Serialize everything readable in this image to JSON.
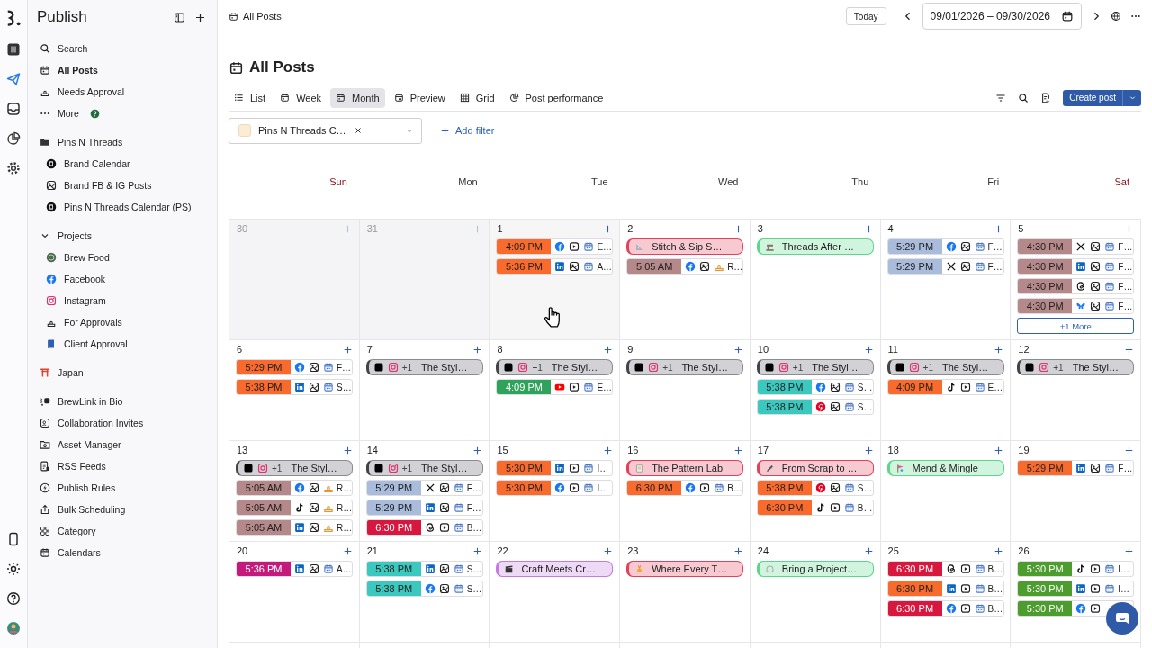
{
  "rail": [
    {
      "kind": "logo",
      "selected": false
    },
    {
      "kind": "app",
      "selected": false
    },
    {
      "kind": "plane",
      "selected": true
    },
    {
      "kind": "inbox",
      "selected": false
    },
    {
      "kind": "pie",
      "selected": false
    },
    {
      "kind": "gear",
      "selected": false
    }
  ],
  "rail_bottom": [
    {
      "kind": "phone"
    },
    {
      "kind": "sun"
    },
    {
      "kind": "help"
    },
    {
      "kind": "avatar"
    }
  ],
  "sidebar": {
    "title": "Publish",
    "sections": [
      {
        "items": [
          {
            "label": "Search",
            "kind": "search",
            "selected": false
          },
          {
            "label": "All Posts",
            "kind": "calendar",
            "selected": true
          },
          {
            "label": "Needs Approval",
            "kind": "stamp",
            "selected": false
          },
          {
            "label": "More",
            "kind": "dots",
            "badge": true,
            "selected": false
          }
        ]
      },
      {
        "items": [
          {
            "label": "Pins N Threads",
            "kind": "folder",
            "selected": false,
            "children": [
              {
                "label": "Brand Calendar",
                "kind": "darkcircle",
                "selected": false
              },
              {
                "label": "Brand FB & IG Posts",
                "kind": "image",
                "selected": false
              },
              {
                "label": "Pins N Threads Calendar (PS)",
                "kind": "darkcircle",
                "selected": false
              }
            ]
          }
        ]
      },
      {
        "items": [
          {
            "label": "Projects",
            "kind": "chevron",
            "expanded": true,
            "selected": false,
            "children": [
              {
                "label": "Brew Food",
                "kind": "brew",
                "selected": false
              },
              {
                "label": "Facebook",
                "kind": "facebook",
                "selected": false
              },
              {
                "label": "Instagram",
                "kind": "instagram",
                "selected": false
              },
              {
                "label": "For Approvals",
                "kind": "stamp",
                "selected": false
              },
              {
                "label": "Client Approval",
                "kind": "book",
                "selected": false
              }
            ]
          }
        ]
      },
      {
        "items": [
          {
            "label": "Japan",
            "kind": "torii",
            "selected": false
          }
        ]
      },
      {
        "items": [
          {
            "label": "BrewLink in Bio",
            "kind": "link",
            "selected": false
          },
          {
            "label": "Collaboration Invites",
            "kind": "personbox",
            "selected": false
          },
          {
            "label": "Asset Manager",
            "kind": "folderimage",
            "selected": false
          },
          {
            "label": "RSS Feeds",
            "kind": "doc",
            "selected": false
          },
          {
            "label": "Publish Rules",
            "kind": "bolt",
            "selected": false
          },
          {
            "label": "Bulk Scheduling",
            "kind": "upload",
            "selected": false
          },
          {
            "label": "Category",
            "kind": "grid",
            "selected": false
          },
          {
            "label": "Calendars",
            "kind": "calendar",
            "selected": false
          }
        ]
      }
    ]
  },
  "topbar": {
    "breadcrumb": "All Posts",
    "today": "Today",
    "date_range": "09/01/2026 – 09/30/2026"
  },
  "heading": "All Posts",
  "views": [
    {
      "label": "List",
      "kind": "list",
      "selected": false
    },
    {
      "label": "Week",
      "kind": "calendar",
      "selected": false
    },
    {
      "label": "Month",
      "kind": "calendar",
      "selected": true
    },
    {
      "label": "Preview",
      "kind": "preview",
      "selected": false
    },
    {
      "label": "Grid",
      "kind": "grid3",
      "selected": false
    },
    {
      "label": "Post performance",
      "kind": "pie",
      "selected": false
    }
  ],
  "create_button": "Create post",
  "filter": {
    "value": "Pins N Threads C…",
    "add_label": "Add filter"
  },
  "calendar": {
    "weekdays": [
      {
        "label": "Sun",
        "weekend": true
      },
      {
        "label": "Mon",
        "weekend": false
      },
      {
        "label": "Tue",
        "weekend": false
      },
      {
        "label": "Wed",
        "weekend": false
      },
      {
        "label": "Thu",
        "weekend": false
      },
      {
        "label": "Fri",
        "weekend": false
      },
      {
        "label": "Sat",
        "weekend": true
      }
    ],
    "weeks": [
      {
        "days": [
          {
            "date": "30",
            "outside": true,
            "hovered": false
          },
          {
            "date": "31",
            "outside": true,
            "hovered": false
          },
          {
            "date": "1",
            "outside": false,
            "hovered": true,
            "posts": [
              {
                "kind": "post",
                "time": "4:09 PM",
                "color": "#f96a2d",
                "icons": [
                  {
                    "kind": "facebook"
                  },
                  {
                    "kind": "video"
                  },
                  {
                    "kind": "calendar"
                  }
                ],
                "label": "E…"
              },
              {
                "kind": "post",
                "time": "5:36 PM",
                "color": "#f96a2d",
                "icons": [
                  {
                    "kind": "linkedin"
                  },
                  {
                    "kind": "image"
                  },
                  {
                    "kind": "calendar"
                  }
                ],
                "label": "A…"
              }
            ]
          },
          {
            "date": "2",
            "outside": false,
            "hovered": false,
            "posts": [
              {
                "kind": "event",
                "title": "Stitch & Sip S…",
                "color": "#e2405c",
                "icon": {
                  "kind": "ruler"
                }
              },
              {
                "kind": "post",
                "time": "5:05 AM",
                "color": "#b5888a",
                "icons": [
                  {
                    "kind": "facebook"
                  },
                  {
                    "kind": "image"
                  },
                  {
                    "kind": "approval"
                  }
                ],
                "label": "R…"
              }
            ]
          },
          {
            "date": "3",
            "outside": false,
            "hovered": false,
            "posts": [
              {
                "kind": "event",
                "title": "Threads After …",
                "color": "#5cd68a",
                "icon": {
                  "kind": "machine"
                }
              }
            ]
          },
          {
            "date": "4",
            "outside": false,
            "hovered": false,
            "posts": [
              {
                "kind": "post",
                "time": "5:29 PM",
                "color": "#a9bcdb",
                "icons": [
                  {
                    "kind": "facebook"
                  },
                  {
                    "kind": "image"
                  },
                  {
                    "kind": "calendar"
                  }
                ],
                "label": "F…"
              },
              {
                "kind": "post",
                "time": "5:29 PM",
                "color": "#a9bcdb",
                "icons": [
                  {
                    "kind": "x"
                  },
                  {
                    "kind": "image"
                  },
                  {
                    "kind": "calendar"
                  }
                ],
                "label": "F…"
              }
            ]
          },
          {
            "date": "5",
            "outside": false,
            "hovered": false,
            "more": "+1 More",
            "posts": [
              {
                "kind": "post",
                "time": "4:30 PM",
                "color": "#b5888a",
                "icons": [
                  {
                    "kind": "x"
                  },
                  {
                    "kind": "image"
                  },
                  {
                    "kind": "calendar"
                  }
                ],
                "label": "F…"
              },
              {
                "kind": "post",
                "time": "4:30 PM",
                "color": "#b5888a",
                "icons": [
                  {
                    "kind": "linkedin"
                  },
                  {
                    "kind": "image"
                  },
                  {
                    "kind": "calendar"
                  }
                ],
                "label": "F…"
              },
              {
                "kind": "post",
                "time": "4:30 PM",
                "color": "#b5888a",
                "icons": [
                  {
                    "kind": "threads"
                  },
                  {
                    "kind": "image"
                  },
                  {
                    "kind": "calendar"
                  }
                ],
                "label": "F…"
              },
              {
                "kind": "post",
                "time": "4:30 PM",
                "color": "#b5888a",
                "icons": [
                  {
                    "kind": "bluesky"
                  },
                  {
                    "kind": "image"
                  },
                  {
                    "kind": "calendar"
                  }
                ],
                "label": "F…"
              }
            ]
          }
        ]
      },
      {
        "days": [
          {
            "date": "6",
            "outside": false,
            "hovered": false,
            "posts": [
              {
                "kind": "post",
                "time": "5:29 PM",
                "color": "#f96a2d",
                "icons": [
                  {
                    "kind": "facebook"
                  },
                  {
                    "kind": "image"
                  },
                  {
                    "kind": "calendar"
                  }
                ],
                "label": "F…"
              },
              {
                "kind": "post",
                "time": "5:38 PM",
                "color": "#f96a2d",
                "icons": [
                  {
                    "kind": "linkedin"
                  },
                  {
                    "kind": "image"
                  },
                  {
                    "kind": "calendar"
                  }
                ],
                "label": "S…"
              }
            ]
          },
          {
            "date": "7",
            "outside": false,
            "hovered": false,
            "posts": [
              {
                "kind": "story",
                "extra": "+1",
                "title": "The Styl…"
              }
            ]
          },
          {
            "date": "8",
            "outside": false,
            "hovered": false,
            "posts": [
              {
                "kind": "story",
                "extra": "+1",
                "title": "The Styl…"
              },
              {
                "kind": "post",
                "time": "4:09 PM",
                "color": "#2fa25b",
                "icons": [
                  {
                    "kind": "youtube"
                  },
                  {
                    "kind": "video"
                  },
                  {
                    "kind": "calendar"
                  }
                ],
                "label": "E…"
              }
            ]
          },
          {
            "date": "9",
            "outside": false,
            "hovered": false,
            "posts": [
              {
                "kind": "story",
                "extra": "+1",
                "title": "The Styl…"
              }
            ]
          },
          {
            "date": "10",
            "outside": false,
            "hovered": false,
            "posts": [
              {
                "kind": "story",
                "extra": "+1",
                "title": "The Styl…"
              },
              {
                "kind": "post",
                "time": "5:38 PM",
                "color": "#3bc8bf",
                "icons": [
                  {
                    "kind": "facebook"
                  },
                  {
                    "kind": "image"
                  },
                  {
                    "kind": "calendar"
                  }
                ],
                "label": "S…"
              },
              {
                "kind": "post",
                "time": "5:38 PM",
                "color": "#3bc8bf",
                "icons": [
                  {
                    "kind": "pinterest"
                  },
                  {
                    "kind": "image"
                  },
                  {
                    "kind": "calendar"
                  }
                ],
                "label": "S…"
              }
            ]
          },
          {
            "date": "11",
            "outside": false,
            "hovered": false,
            "posts": [
              {
                "kind": "story",
                "extra": "+1",
                "title": "The Styl…"
              },
              {
                "kind": "post",
                "time": "4:09 PM",
                "color": "#f96a2d",
                "icons": [
                  {
                    "kind": "tiktok"
                  },
                  {
                    "kind": "video"
                  },
                  {
                    "kind": "calendar"
                  }
                ],
                "label": "E…"
              }
            ]
          },
          {
            "date": "12",
            "outside": false,
            "hovered": false,
            "posts": [
              {
                "kind": "story",
                "extra": "+1",
                "title": "The Styl…"
              }
            ]
          }
        ]
      },
      {
        "days": [
          {
            "date": "13",
            "outside": false,
            "hovered": false,
            "posts": [
              {
                "kind": "story",
                "extra": "+1",
                "title": "The Styl…"
              },
              {
                "kind": "post",
                "time": "5:05 AM",
                "color": "#b5888a",
                "icons": [
                  {
                    "kind": "facebook"
                  },
                  {
                    "kind": "image"
                  },
                  {
                    "kind": "approval"
                  }
                ],
                "label": "R…"
              },
              {
                "kind": "post",
                "time": "5:05 AM",
                "color": "#b5888a",
                "icons": [
                  {
                    "kind": "tiktok"
                  },
                  {
                    "kind": "image"
                  },
                  {
                    "kind": "approval"
                  }
                ],
                "label": "R…"
              },
              {
                "kind": "post",
                "time": "5:05 AM",
                "color": "#b5888a",
                "icons": [
                  {
                    "kind": "linkedin"
                  },
                  {
                    "kind": "image"
                  },
                  {
                    "kind": "approval"
                  }
                ],
                "label": "R…"
              }
            ]
          },
          {
            "date": "14",
            "outside": false,
            "hovered": false,
            "posts": [
              {
                "kind": "story",
                "extra": "+1",
                "title": "The Styl…"
              },
              {
                "kind": "post",
                "time": "5:29 PM",
                "color": "#a9bcdb",
                "icons": [
                  {
                    "kind": "x"
                  },
                  {
                    "kind": "image"
                  },
                  {
                    "kind": "calendar"
                  }
                ],
                "label": "F…"
              },
              {
                "kind": "post",
                "time": "5:29 PM",
                "color": "#a9bcdb",
                "icons": [
                  {
                    "kind": "linkedin"
                  },
                  {
                    "kind": "image"
                  },
                  {
                    "kind": "calendar"
                  }
                ],
                "label": "F…"
              },
              {
                "kind": "post",
                "time": "6:30 PM",
                "color": "#d8173e",
                "icons": [
                  {
                    "kind": "threads"
                  },
                  {
                    "kind": "video"
                  },
                  {
                    "kind": "calendar"
                  }
                ],
                "label": "B…"
              }
            ]
          },
          {
            "date": "15",
            "outside": false,
            "hovered": false,
            "posts": [
              {
                "kind": "post",
                "time": "5:30 PM",
                "color": "#f96a2d",
                "icons": [
                  {
                    "kind": "linkedin"
                  },
                  {
                    "kind": "video"
                  },
                  {
                    "kind": "calendar"
                  }
                ],
                "label": "I…"
              },
              {
                "kind": "post",
                "time": "5:30 PM",
                "color": "#f96a2d",
                "icons": [
                  {
                    "kind": "facebook"
                  },
                  {
                    "kind": "video"
                  },
                  {
                    "kind": "calendar"
                  }
                ],
                "label": "I…"
              }
            ]
          },
          {
            "date": "16",
            "outside": false,
            "hovered": false,
            "posts": [
              {
                "kind": "event",
                "title": "The Pattern Lab",
                "color": "#e2405c",
                "icon": {
                  "kind": "notepad"
                }
              },
              {
                "kind": "post",
                "time": "6:30 PM",
                "color": "#f96a2d",
                "icons": [
                  {
                    "kind": "facebook"
                  },
                  {
                    "kind": "video"
                  },
                  {
                    "kind": "calendar"
                  }
                ],
                "label": "B…"
              }
            ]
          },
          {
            "date": "17",
            "outside": false,
            "hovered": false,
            "posts": [
              {
                "kind": "event",
                "title": "From Scrap to …",
                "color": "#e2405c",
                "icon": {
                  "kind": "pen"
                }
              },
              {
                "kind": "post",
                "time": "5:38 PM",
                "color": "#f96a2d",
                "icons": [
                  {
                    "kind": "pinterest"
                  },
                  {
                    "kind": "image"
                  },
                  {
                    "kind": "calendar"
                  }
                ],
                "label": "S…"
              },
              {
                "kind": "post",
                "time": "6:30 PM",
                "color": "#f96a2d",
                "icons": [
                  {
                    "kind": "tiktok"
                  },
                  {
                    "kind": "video"
                  },
                  {
                    "kind": "calendar"
                  }
                ],
                "label": "B…"
              }
            ]
          },
          {
            "date": "18",
            "outside": false,
            "hovered": false,
            "posts": [
              {
                "kind": "event",
                "title": "Mend & Mingle",
                "color": "#5cd68a",
                "icon": {
                  "kind": "flag"
                }
              }
            ]
          },
          {
            "date": "19",
            "outside": false,
            "hovered": false,
            "posts": [
              {
                "kind": "post",
                "time": "5:29 PM",
                "color": "#f96a2d",
                "icons": [
                  {
                    "kind": "linkedin"
                  },
                  {
                    "kind": "image"
                  },
                  {
                    "kind": "calendar"
                  }
                ],
                "label": "F…"
              }
            ]
          }
        ]
      },
      {
        "days": [
          {
            "date": "20",
            "outside": false,
            "hovered": false,
            "posts": [
              {
                "kind": "post",
                "time": "5:36 PM",
                "color": "#c41a7b",
                "icons": [
                  {
                    "kind": "linkedin"
                  },
                  {
                    "kind": "image"
                  },
                  {
                    "kind": "calendar"
                  }
                ],
                "label": "A…"
              }
            ]
          },
          {
            "date": "21",
            "outside": false,
            "hovered": false,
            "posts": [
              {
                "kind": "post",
                "time": "5:38 PM",
                "color": "#3bc8bf",
                "icons": [
                  {
                    "kind": "linkedin"
                  },
                  {
                    "kind": "image"
                  },
                  {
                    "kind": "calendar"
                  }
                ],
                "label": "S…"
              },
              {
                "kind": "post",
                "time": "5:38 PM",
                "color": "#3bc8bf",
                "icons": [
                  {
                    "kind": "facebook"
                  },
                  {
                    "kind": "image"
                  },
                  {
                    "kind": "calendar"
                  }
                ],
                "label": "S…"
              }
            ]
          },
          {
            "date": "22",
            "outside": false,
            "hovered": false,
            "posts": [
              {
                "kind": "event",
                "title": "Craft Meets Cr…",
                "color": "#c47ae0",
                "icon": {
                  "kind": "clapper"
                }
              }
            ]
          },
          {
            "date": "23",
            "outside": false,
            "hovered": false,
            "posts": [
              {
                "kind": "event",
                "title": "Where Every T…",
                "color": "#e2405c",
                "icon": {
                  "kind": "medal"
                }
              }
            ]
          },
          {
            "date": "24",
            "outside": false,
            "hovered": false,
            "posts": [
              {
                "kind": "event",
                "title": "Bring a Project…",
                "color": "#5cd68a",
                "icon": {
                  "kind": "headphones"
                }
              }
            ]
          },
          {
            "date": "25",
            "outside": false,
            "hovered": false,
            "posts": [
              {
                "kind": "post",
                "time": "6:30 PM",
                "color": "#d8173e",
                "icons": [
                  {
                    "kind": "threads"
                  },
                  {
                    "kind": "video"
                  },
                  {
                    "kind": "calendar"
                  }
                ],
                "label": "B…"
              },
              {
                "kind": "post",
                "time": "6:30 PM",
                "color": "#f96a2d",
                "icons": [
                  {
                    "kind": "linkedin"
                  },
                  {
                    "kind": "video"
                  },
                  {
                    "kind": "calendar"
                  }
                ],
                "label": "B…"
              },
              {
                "kind": "post",
                "time": "6:30 PM",
                "color": "#d8173e",
                "icons": [
                  {
                    "kind": "facebook"
                  },
                  {
                    "kind": "video"
                  },
                  {
                    "kind": "calendar"
                  }
                ],
                "label": "B…"
              }
            ]
          },
          {
            "date": "26",
            "outside": false,
            "hovered": false,
            "posts": [
              {
                "kind": "post",
                "time": "5:30 PM",
                "color": "#4c9c2e",
                "icons": [
                  {
                    "kind": "tiktok"
                  },
                  {
                    "kind": "video"
                  },
                  {
                    "kind": "calendar"
                  }
                ],
                "label": "I…"
              },
              {
                "kind": "post",
                "time": "5:30 PM",
                "color": "#4c9c2e",
                "icons": [
                  {
                    "kind": "linkedin"
                  },
                  {
                    "kind": "video"
                  },
                  {
                    "kind": "calendar"
                  }
                ],
                "label": "I…"
              },
              {
                "kind": "post",
                "time": "5:30 PM",
                "color": "#4c9c2e",
                "icons": [
                  {
                    "kind": "facebook"
                  },
                  {
                    "kind": "video"
                  }
                ]
              }
            ]
          }
        ]
      }
    ]
  }
}
